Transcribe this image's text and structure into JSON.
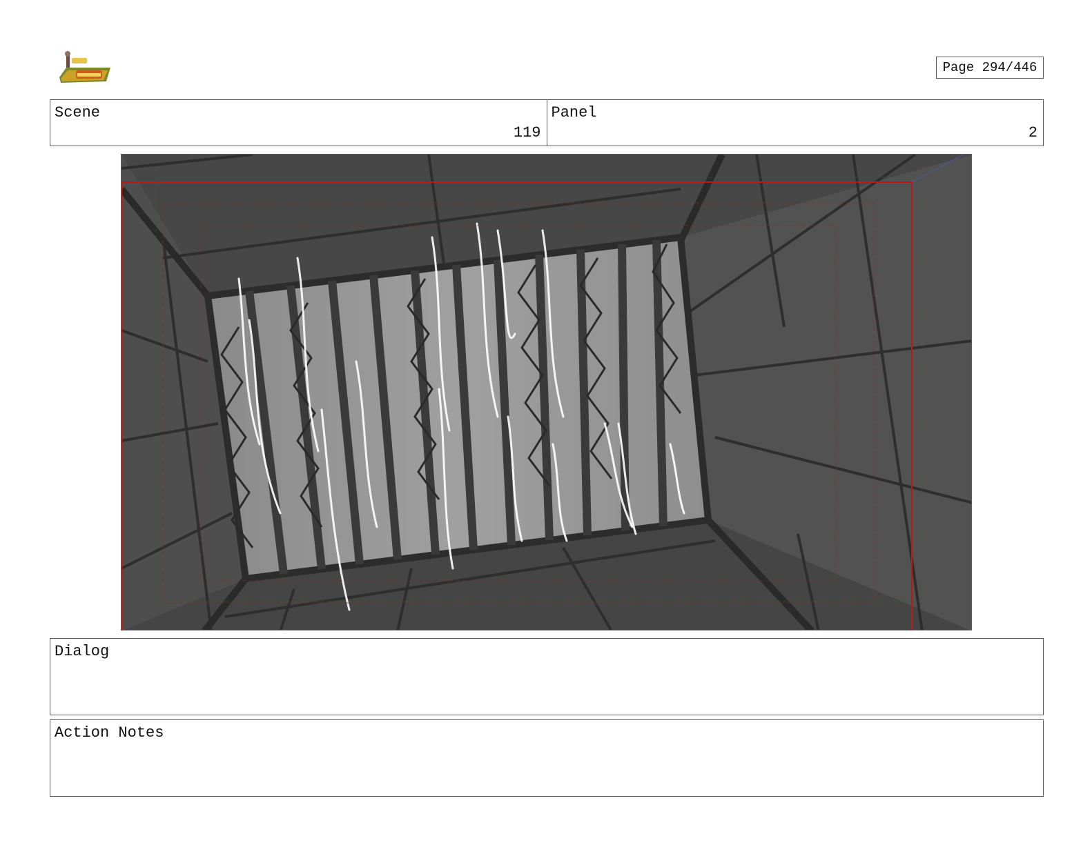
{
  "header": {
    "page_label": "Page 294/446"
  },
  "info": {
    "scene_label": "Scene",
    "scene_value": "119",
    "panel_label": "Panel",
    "panel_value": "2"
  },
  "dialog": {
    "label": "Dialog"
  },
  "action_notes": {
    "label": "Action Notes"
  },
  "colors": {
    "frame_border": "#2e7d32",
    "safe_area": "#b71c1c",
    "background_dark": "#3c3c3c",
    "background_mid": "#5a5a5a",
    "grate_light": "#9a9a9a"
  }
}
